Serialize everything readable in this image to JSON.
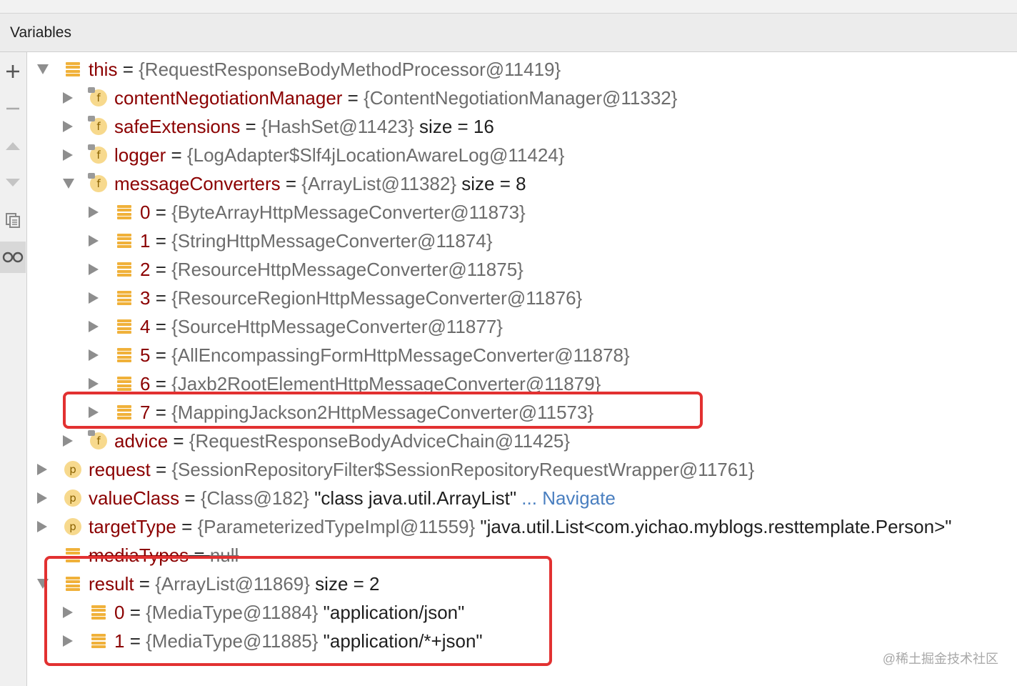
{
  "panel": {
    "title": "Variables"
  },
  "rows": [
    {
      "name": "this",
      "eq": " = ",
      "val": "{RequestResponseBodyMethodProcessor@11419}",
      "extra": "",
      "str": "",
      "link": ""
    },
    {
      "name": "contentNegotiationManager",
      "eq": " = ",
      "val": "{ContentNegotiationManager@11332}",
      "extra": "",
      "str": "",
      "link": ""
    },
    {
      "name": "safeExtensions",
      "eq": " = ",
      "val": "{HashSet@11423}",
      "extra": "  size = 16",
      "str": "",
      "link": ""
    },
    {
      "name": "logger",
      "eq": " = ",
      "val": "{LogAdapter$Slf4jLocationAwareLog@11424}",
      "extra": "",
      "str": "",
      "link": ""
    },
    {
      "name": "messageConverters",
      "eq": " = ",
      "val": "{ArrayList@11382}",
      "extra": "  size = 8",
      "str": "",
      "link": ""
    },
    {
      "name": "0",
      "eq": " = ",
      "val": "{ByteArrayHttpMessageConverter@11873}",
      "extra": "",
      "str": "",
      "link": ""
    },
    {
      "name": "1",
      "eq": " = ",
      "val": "{StringHttpMessageConverter@11874}",
      "extra": "",
      "str": "",
      "link": ""
    },
    {
      "name": "2",
      "eq": " = ",
      "val": "{ResourceHttpMessageConverter@11875}",
      "extra": "",
      "str": "",
      "link": ""
    },
    {
      "name": "3",
      "eq": " = ",
      "val": "{ResourceRegionHttpMessageConverter@11876}",
      "extra": "",
      "str": "",
      "link": ""
    },
    {
      "name": "4",
      "eq": " = ",
      "val": "{SourceHttpMessageConverter@11877}",
      "extra": "",
      "str": "",
      "link": ""
    },
    {
      "name": "5",
      "eq": " = ",
      "val": "{AllEncompassingFormHttpMessageConverter@11878}",
      "extra": "",
      "str": "",
      "link": ""
    },
    {
      "name": "6",
      "eq": " = ",
      "val": "{Jaxb2RootElementHttpMessageConverter@11879}",
      "extra": "",
      "str": "",
      "link": ""
    },
    {
      "name": "7",
      "eq": " = ",
      "val": "{MappingJackson2HttpMessageConverter@11573}",
      "extra": "",
      "str": "",
      "link": ""
    },
    {
      "name": "advice",
      "eq": " = ",
      "val": "{RequestResponseBodyAdviceChain@11425}",
      "extra": "",
      "str": "",
      "link": ""
    },
    {
      "name": "request",
      "eq": " = ",
      "val": "{SessionRepositoryFilter$SessionRepositoryRequestWrapper@11761}",
      "extra": "",
      "str": "",
      "link": ""
    },
    {
      "name": "valueClass",
      "eq": " = ",
      "val": "{Class@182}",
      "extra": "",
      "str": " \"class java.util.ArrayList\"",
      "link": " ... Navigate"
    },
    {
      "name": "targetType",
      "eq": " = ",
      "val": "{ParameterizedTypeImpl@11559}",
      "extra": "",
      "str": " \"java.util.List<com.yichao.myblogs.resttemplate.Person>\"",
      "link": ""
    },
    {
      "name": "mediaTypes",
      "eq": " = ",
      "val": "null",
      "extra": "",
      "str": "",
      "link": ""
    },
    {
      "name": "result",
      "eq": " = ",
      "val": "{ArrayList@11869}",
      "extra": "  size = 2",
      "str": "",
      "link": ""
    },
    {
      "name": "0",
      "eq": " = ",
      "val": "{MediaType@11884}",
      "extra": "",
      "str": " \"application/json\"",
      "link": ""
    },
    {
      "name": "1",
      "eq": " = ",
      "val": "{MediaType@11885}",
      "extra": "",
      "str": " \"application/*+json\"",
      "link": ""
    }
  ],
  "watermark": "@稀土掘金技术社区"
}
